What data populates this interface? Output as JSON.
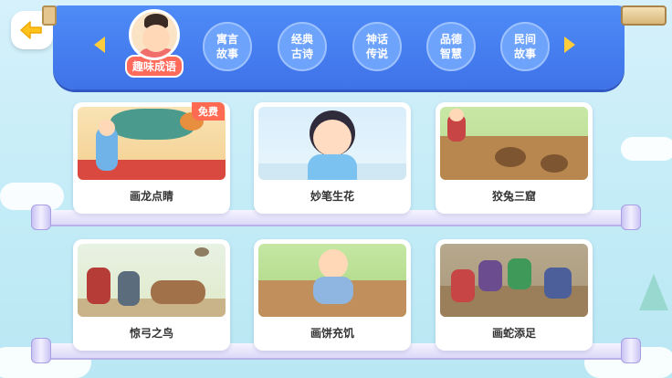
{
  "colors": {
    "banner": "#4e8cf7",
    "accent_red": "#ff6a5b",
    "arrow": "#ffcd3c",
    "card_text": "#333333"
  },
  "nav": {
    "back_icon": "back-arrow-icon",
    "prev_icon": "chevron-left-icon",
    "next_icon": "chevron-right-icon"
  },
  "categories": {
    "active": {
      "label": "趣味成语"
    },
    "items": [
      {
        "line1": "寓言",
        "line2": "故事"
      },
      {
        "line1": "经典",
        "line2": "古诗"
      },
      {
        "line1": "神话",
        "line2": "传说"
      },
      {
        "line1": "品德",
        "line2": "智慧"
      },
      {
        "line1": "民间",
        "line2": "故事"
      }
    ]
  },
  "stories": [
    {
      "title": "画龙点睛",
      "tag": "免费"
    },
    {
      "title": "妙笔生花"
    },
    {
      "title": "狡兔三窟"
    },
    {
      "title": "惊弓之鸟"
    },
    {
      "title": "画饼充饥"
    },
    {
      "title": "画蛇添足"
    }
  ]
}
